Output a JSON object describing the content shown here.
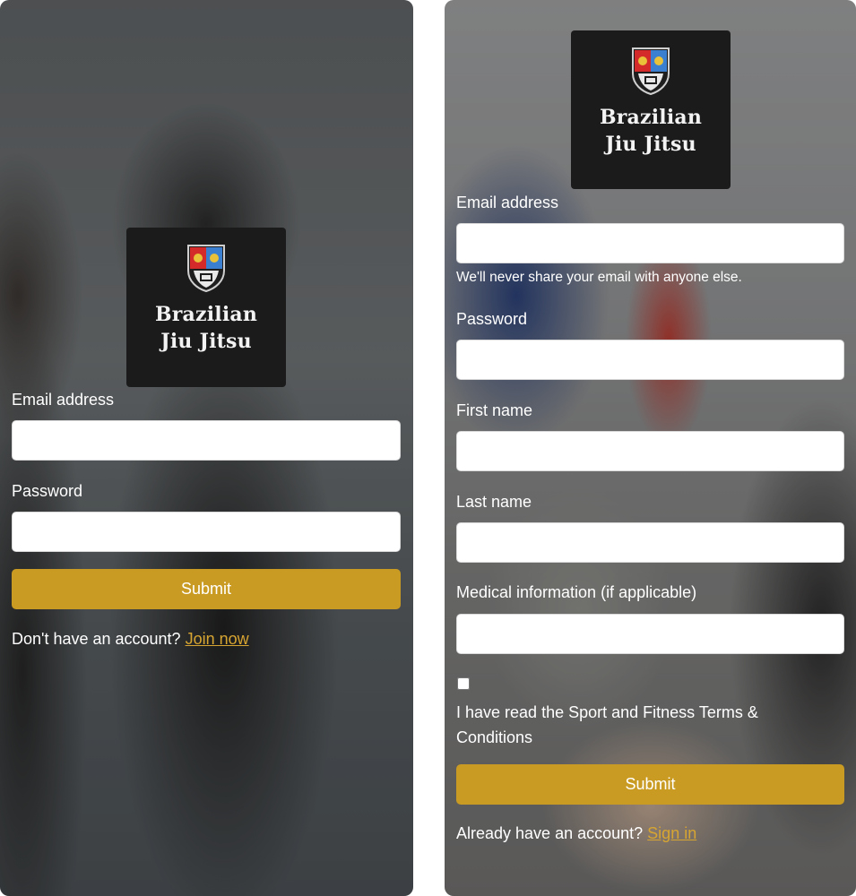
{
  "login": {
    "logo": {
      "line1": "Brazilian",
      "line2": "Jiu Jitsu"
    },
    "email_label": "Email address",
    "email_value": "",
    "password_label": "Password",
    "password_value": "",
    "submit_label": "Submit",
    "footer_prompt": "Don't have an account?",
    "footer_link": "Join now"
  },
  "signup": {
    "logo": {
      "line1": "Brazilian",
      "line2": "Jiu Jitsu"
    },
    "email_label": "Email address",
    "email_value": "",
    "email_help": "We'll never share your email with anyone else.",
    "password_label": "Password",
    "password_value": "",
    "first_name_label": "First name",
    "first_name_value": "",
    "last_name_label": "Last name",
    "last_name_value": "",
    "medical_label": "Medical information (if applicable)",
    "medical_value": "",
    "terms_checked": false,
    "terms_label_line1": "I have read the Sport and Fitness Terms &",
    "terms_label_line2": "Conditions",
    "submit_label": "Submit",
    "footer_prompt": "Already have an account?",
    "footer_link": "Sign in"
  },
  "colors": {
    "accent": "#c99b23",
    "link": "#d7a531",
    "logo_background": "#1b1b1b"
  },
  "icons": [
    "university-crest-icon"
  ]
}
